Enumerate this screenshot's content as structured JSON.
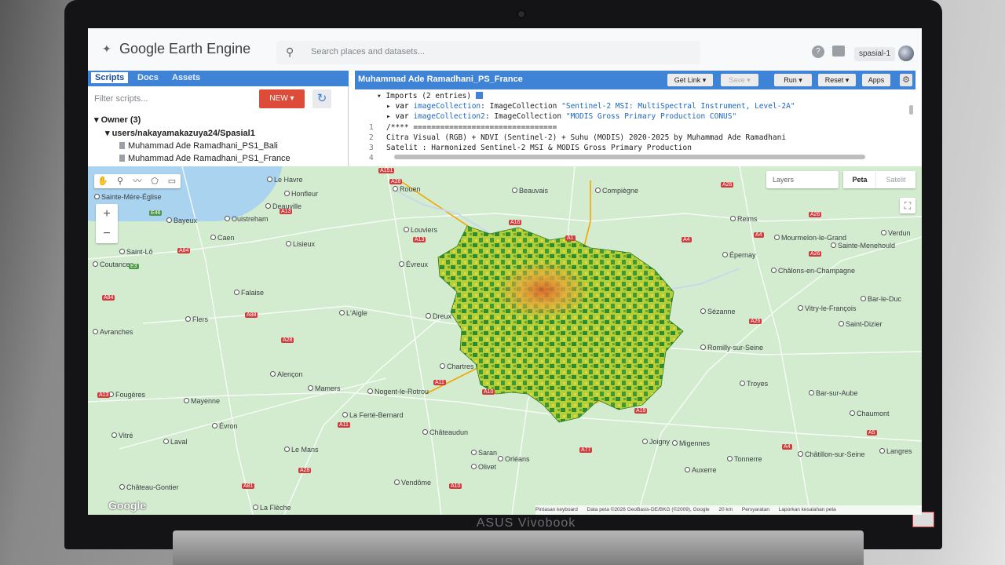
{
  "device": {
    "brand": "ASUS Vivobook"
  },
  "header": {
    "app_title": "Google Earth Engine",
    "search_placeholder": "Search places and datasets...",
    "help_label": "?",
    "user": "spasial-1"
  },
  "left_panel": {
    "tabs": [
      "Scripts",
      "Docs",
      "Assets"
    ],
    "filter_placeholder": "Filter scripts...",
    "new_button": "NEW ▾",
    "tree": {
      "owner": "▾ Owner (3)",
      "repo": "▾ users/nakayamakazuya24/Spasial1",
      "files": [
        "Muhammad Ade Ramadhani_PS1_Bali",
        "Muhammad Ade Ramadhani_PS1_France"
      ]
    }
  },
  "editor": {
    "script_title": "Muhammad Ade Ramadhani_PS_France",
    "buttons": {
      "get_link": "Get Link ▾",
      "save": "Save ▾",
      "run": "Run ▾",
      "reset": "Reset ▾",
      "apps": "Apps"
    },
    "imports_header": "Imports (2 entries)",
    "imports": [
      {
        "kw": "var",
        "name": "imageCollection",
        "type": "ImageCollection",
        "desc": "\"Sentinel-2 MSI: MultiSpectral Instrument, Level-2A\""
      },
      {
        "kw": "var",
        "name": "imageCollection2",
        "type": "ImageCollection",
        "desc": "\"MODIS Gross Primary Production CONUS\""
      }
    ],
    "line_numbers": [
      "1",
      "2",
      "3",
      "4"
    ],
    "lines": [
      "/**** ================================",
      "Citra Visual (RGB) + NDVI (Sentinel-2) + Suhu (MODIS) 2020-2025 by Muhammad Ade Ramadhani",
      "Satelit : Harmonized Sentinel-2 MSI & MODIS Gross Primary Production",
      ""
    ]
  },
  "map": {
    "controls": {
      "zoom_in": "+",
      "zoom_out": "−",
      "layers": "Layers",
      "map_type_active": "Peta",
      "map_type_inactive": "Satelit"
    },
    "places": [
      "Le Havre",
      "Honfleur",
      "Rouen",
      "Beauvais",
      "Compiègne",
      "Sainte-Mère-Église",
      "Deauville",
      "Bayeux",
      "Ouistreham",
      "Caen",
      "Lisieux",
      "Louviers",
      "Évreux",
      "Saint-Lô",
      "Falaise",
      "Flers",
      "L'Aigle",
      "Dreux",
      "Chartres",
      "Alençon",
      "Mamers",
      "Nogent-le-Rotrou",
      "Fougères",
      "Mayenne",
      "Évron",
      "Laval",
      "Vitré",
      "Le Mans",
      "Château-Gontier",
      "Châteaudun",
      "Orléans",
      "Saran",
      "Olivet",
      "Vendôme",
      "La Ferté-Bernard",
      "Reims",
      "Épernay",
      "Châlons-en-Champagne",
      "Mourmelon-le-Grand",
      "Sainte-Menehould",
      "Verdun",
      "Vitry-le-François",
      "Saint-Dizier",
      "Bar-le-Duc",
      "Sézanne",
      "Romilly-sur-Seine",
      "Troyes",
      "Bar-sur-Aube",
      "Chaumont",
      "Joigny",
      "Migennes",
      "Tonnerre",
      "Auxerre",
      "Châtillon-sur-Seine",
      "Langres",
      "Avranches",
      "La Flèche",
      "Coutances"
    ],
    "roads": [
      "A151",
      "A28",
      "A16",
      "A1",
      "A13",
      "A84",
      "E46",
      "A13",
      "A88",
      "A28",
      "A4",
      "A26",
      "A26",
      "A4",
      "A11",
      "A10",
      "A11",
      "A19",
      "A77",
      "A28",
      "A10",
      "A81",
      "A84",
      "A13",
      "A5",
      "A26",
      "A26",
      "A4",
      "E3"
    ],
    "attribution": [
      "Pintasan keyboard",
      "Data peta ©2026 GeoBasis-DE/BKG (©2009), Google",
      "20 km",
      "Persyaratan",
      "Laporkan kesalahan peta"
    ],
    "logo": "Google"
  },
  "colors": {
    "panel_blue": "#3f83d6",
    "new_red": "#dd4b39",
    "ndvi_dark": "#2e8b2e",
    "ndvi_light": "#c8d83a"
  }
}
